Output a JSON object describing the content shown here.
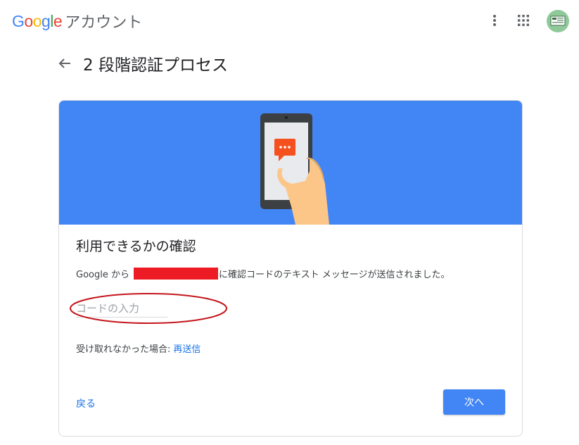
{
  "topbar": {
    "logo_text": "Google",
    "product_name": "アカウント",
    "icons": [
      "more-vert-icon",
      "apps-grid-icon",
      "account-avatar"
    ]
  },
  "header": {
    "title": "2 段階認証プロセス"
  },
  "card": {
    "title": "利用できるかの確認",
    "desc_prefix": "Google から",
    "desc_suffix": "に確認コードのテキスト メッセージが送信されました。",
    "code_placeholder": "コードの入力",
    "resend_prompt": "受け取れなかった場合:",
    "resend_link": "再送信",
    "back_label": "戻る",
    "next_label": "次へ"
  },
  "colors": {
    "hero_blue": "#4285f4",
    "link_blue": "#1a73e8",
    "redaction_red": "#ed1c24",
    "annotation_circle": "#c4161c"
  }
}
